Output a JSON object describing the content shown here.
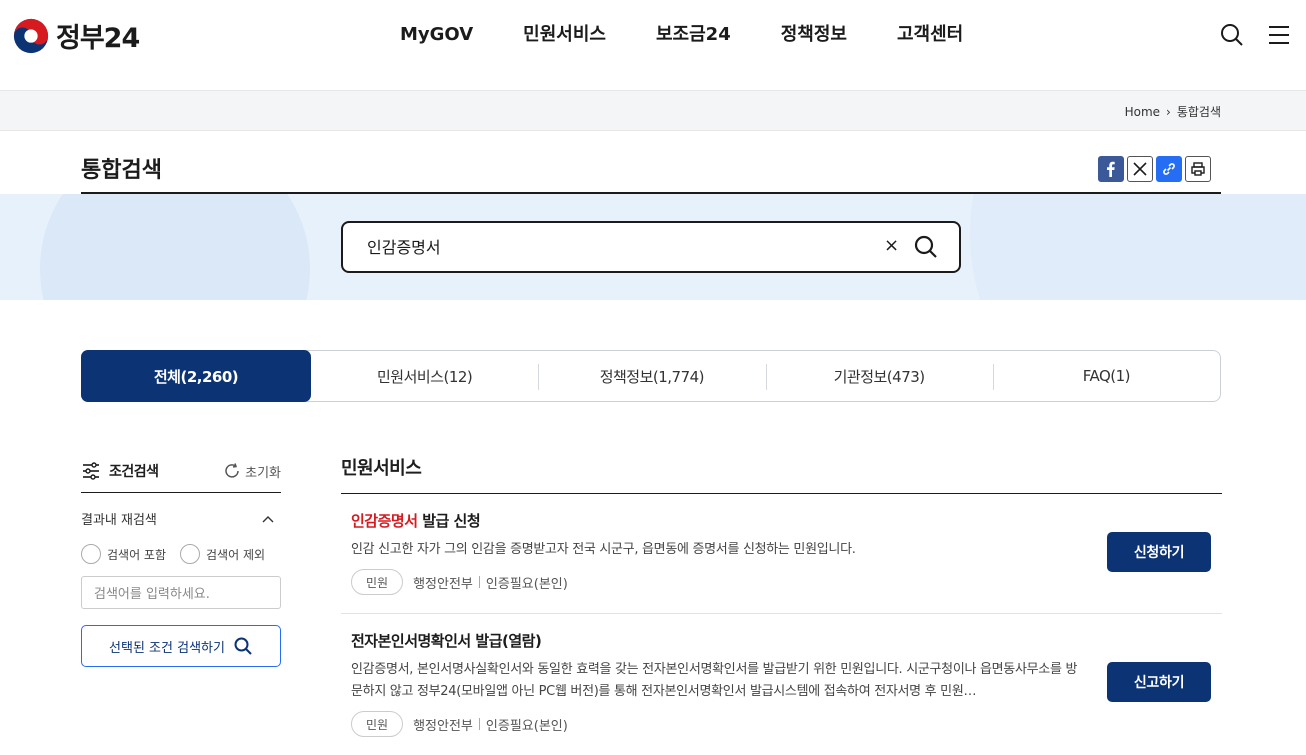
{
  "header": {
    "logo_text": "정부24",
    "nav": [
      "MyGOV",
      "민원서비스",
      "보조금24",
      "정책정보",
      "고객센터"
    ]
  },
  "breadcrumb": {
    "home": "Home",
    "current": "통합검색"
  },
  "page": {
    "title": "통합검색"
  },
  "search": {
    "value": "인감증명서",
    "clear": "×"
  },
  "tabs": [
    {
      "label": "전체(2,260)",
      "active": true
    },
    {
      "label": "민원서비스(12)"
    },
    {
      "label": "정책정보(1,774)"
    },
    {
      "label": "기관정보(473)"
    },
    {
      "label": "FAQ(1)"
    }
  ],
  "filter": {
    "title": "조건검색",
    "reset": "초기화",
    "refine_label": "결과내 재검색",
    "include": "검색어 포함",
    "exclude": "검색어 제외",
    "placeholder": "검색어를 입력하세요.",
    "submit": "선택된 조건 검색하기"
  },
  "results": {
    "section_title": "민원서비스",
    "items": [
      {
        "title_highlight": "인감증명서",
        "title_rest": " 발급 신청",
        "desc": "인감 신고한 자가 그의 인감을 증명받고자 전국 시군구, 읍면동에 증명서를 신청하는 민원입니다.",
        "chip": "민원",
        "agency": "행정안전부",
        "auth": "인증필요(본인)",
        "button": "신청하기"
      },
      {
        "title_highlight": "",
        "title_rest": "전자본인서명확인서 발급(열람)",
        "desc": "인감증명서, 본인서명사실확인서와 동일한 효력을 갖는 전자본인서명확인서를 발급받기 위한 민원입니다. 시군구청이나 읍면동사무소를 방문하지 않고 정부24(모바일앱 아닌 PC웹 버전)를 통해 전자본인서명확인서 발급시스템에 접속하여 전자서명 후 민원…",
        "chip": "민원",
        "agency": "행정안전부",
        "auth": "인증필요(본인)",
        "button": "신고하기"
      }
    ]
  },
  "colors": {
    "primary": "#0c3374",
    "highlight": "#d71920",
    "hero_bg": "#e7f1fc",
    "link_blue": "#256ef4"
  }
}
